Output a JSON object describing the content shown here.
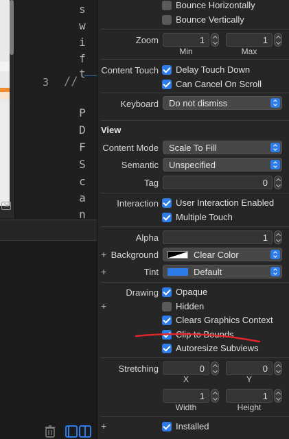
{
  "editor": {
    "code_chars": [
      "s",
      "w",
      "i",
      "f",
      "t",
      "P",
      "D",
      "F",
      "S",
      "c",
      "a",
      "n",
      "n"
    ],
    "line_number": "3",
    "line_comment": "//"
  },
  "inspector": {
    "scroll_view": {
      "bounce_horizontally": {
        "label": "Bounce Horizontally",
        "checked": false
      },
      "bounce_vertically": {
        "label": "Bounce Vertically",
        "checked": false
      },
      "zoom": {
        "label": "Zoom",
        "min_value": "1",
        "max_value": "1",
        "min_label": "Min",
        "max_label": "Max"
      },
      "content_touch": {
        "label": "Content Touch",
        "delay_touch_down": {
          "label": "Delay Touch Down",
          "checked": true
        },
        "can_cancel_on_scroll": {
          "label": "Can Cancel On Scroll",
          "checked": true
        }
      },
      "keyboard": {
        "label": "Keyboard",
        "value": "Do not dismiss"
      }
    },
    "view": {
      "section_title": "View",
      "content_mode": {
        "label": "Content Mode",
        "value": "Scale To Fill"
      },
      "semantic": {
        "label": "Semantic",
        "value": "Unspecified"
      },
      "tag": {
        "label": "Tag",
        "value": "0"
      },
      "interaction": {
        "label": "Interaction",
        "user_interaction_enabled": {
          "label": "User Interaction Enabled",
          "checked": true
        },
        "multiple_touch": {
          "label": "Multiple Touch",
          "checked": true
        }
      },
      "alpha": {
        "label": "Alpha",
        "value": "1"
      },
      "background": {
        "label": "Background",
        "value": "Clear Color"
      },
      "tint": {
        "label": "Tint",
        "value": "Default",
        "color": "#2e7ce8"
      },
      "drawing": {
        "label": "Drawing",
        "opaque": {
          "label": "Opaque",
          "checked": true
        },
        "hidden": {
          "label": "Hidden",
          "checked": false
        },
        "clears_graphics_context": {
          "label": "Clears Graphics Context",
          "checked": true
        },
        "clip_to_bounds": {
          "label": "Clip to Bounds",
          "checked": true
        },
        "autoresize_subviews": {
          "label": "Autoresize Subviews",
          "checked": true
        }
      },
      "stretching": {
        "label": "Stretching",
        "x": {
          "value": "0",
          "label": "X"
        },
        "y": {
          "value": "0",
          "label": "Y"
        },
        "width": {
          "value": "1",
          "label": "Width"
        },
        "height": {
          "value": "1",
          "label": "Height"
        }
      },
      "installed": {
        "label": "Installed",
        "checked": true
      }
    }
  },
  "colors": {
    "accent": "#2e7ce8",
    "annotation": "#e0262b",
    "panel_bg": "#262626"
  }
}
